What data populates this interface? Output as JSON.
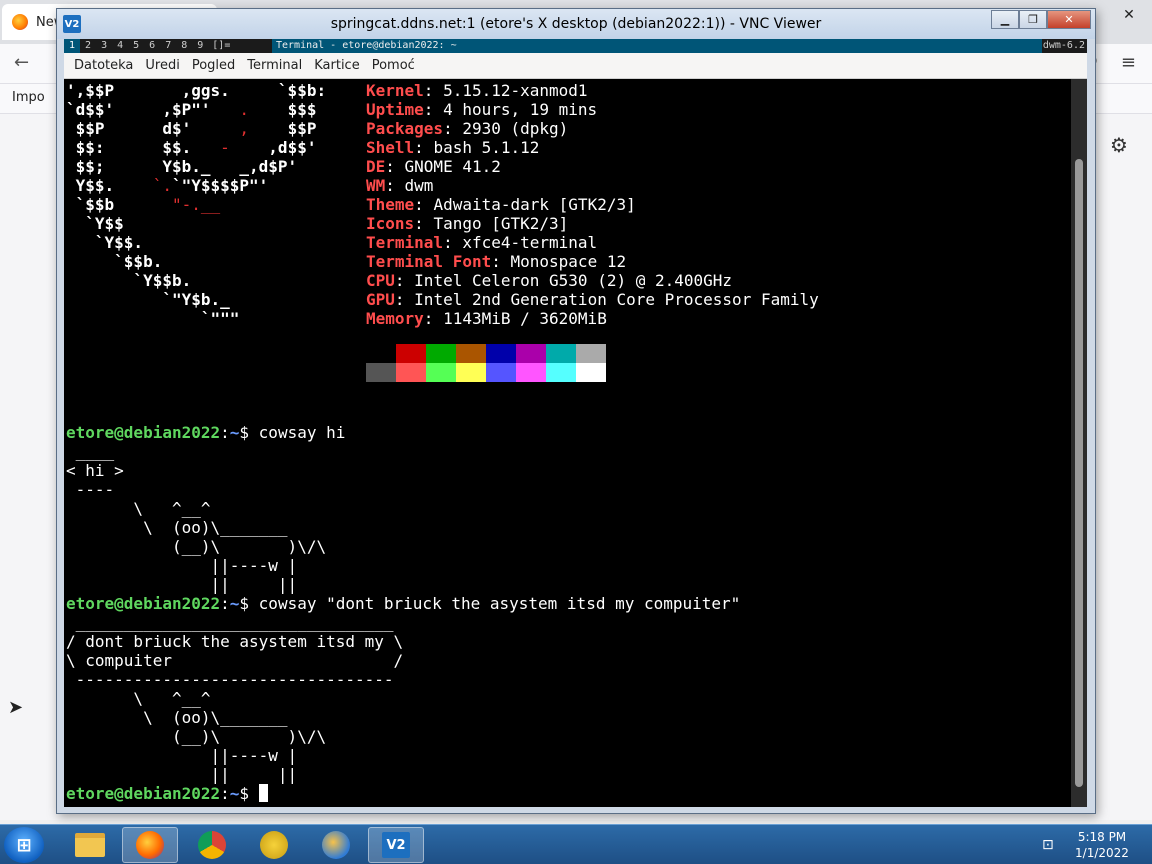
{
  "firefox": {
    "tab_label": "New",
    "bookmark_label": "Impo",
    "tab_close": "✕",
    "back_glyph": "←",
    "menu_glyph": "≡",
    "minimize_glyph": "—",
    "restore_glyph": "▢",
    "close_glyph": "✕",
    "gear_glyph": "⚙",
    "ext_glyph": "⊕"
  },
  "vnc": {
    "title": "springcat.ddns.net:1 (etore's X desktop (debian2022:1)) - VNC Viewer",
    "logo": "V2",
    "minimize": "▁",
    "restore": "❐",
    "close": "✕"
  },
  "dwm": {
    "tags": [
      "1",
      "2",
      "3",
      "4",
      "5",
      "6",
      "7",
      "8",
      "9"
    ],
    "active_tag": "1",
    "layout": "[]=",
    "window_title": "Terminal - etore@debian2022: ~",
    "status": "dwm-6.2"
  },
  "terminal_menu": [
    "Datoteka",
    "Uredi",
    "Pogled",
    "Terminal",
    "Kartice",
    "Pomoć"
  ],
  "neofetch": {
    "art": [
      {
        "white": "',$$P       ,ggs.     `$$b:",
        "red": ""
      },
      {
        "white": "`d$$'     ,$P\"'   ",
        "red": ".",
        "white2": "    $$$"
      },
      {
        "white": " $$P      d$'     ",
        "red": ",",
        "white2": "    $$P"
      },
      {
        "white": " $$:      $$.   ",
        "red": "-",
        "white2": "    ,d$$'"
      },
      {
        "white": " $$;      Y$b._   _,d$P'",
        "red": ""
      },
      {
        "white": " Y$$.    ",
        "red": "`.",
        "white2": "`\"Y$$$$P\"'"
      },
      {
        "white": " `$$b      ",
        "red": "\"-.__",
        "white2": ""
      },
      {
        "white": "  `Y$$",
        "red": "",
        "white2": ""
      },
      {
        "white": "   `Y$$.",
        "red": "",
        "white2": ""
      },
      {
        "white": "     `$$b.",
        "red": "",
        "white2": ""
      },
      {
        "white": "       `Y$$b.",
        "red": "",
        "white2": ""
      },
      {
        "white": "          `\"Y$b._",
        "red": "",
        "white2": ""
      },
      {
        "white": "              `\"\"\"",
        "red": "",
        "white2": ""
      }
    ],
    "info": [
      {
        "key": "Kernel",
        "value": "5.15.12-xanmod1"
      },
      {
        "key": "Uptime",
        "value": "4 hours, 19 mins"
      },
      {
        "key": "Packages",
        "value": "2930 (dpkg)"
      },
      {
        "key": "Shell",
        "value": "bash 5.1.12"
      },
      {
        "key": "DE",
        "value": "GNOME 41.2"
      },
      {
        "key": "WM",
        "value": "dwm"
      },
      {
        "key": "Theme",
        "value": "Adwaita-dark [GTK2/3]"
      },
      {
        "key": "Icons",
        "value": "Tango [GTK2/3]"
      },
      {
        "key": "Terminal",
        "value": "xfce4-terminal"
      },
      {
        "key": "Terminal Font",
        "value": "Monospace 12"
      },
      {
        "key": "CPU",
        "value": "Intel Celeron G530 (2) @ 2.400GHz"
      },
      {
        "key": "GPU",
        "value": "Intel 2nd Generation Core Processor Family"
      },
      {
        "key": "Memory",
        "value": "1143MiB / 3620MiB"
      }
    ],
    "palette_row1": [
      "#000000",
      "#cc0000",
      "#00aa00",
      "#aa5500",
      "#0000aa",
      "#aa00aa",
      "#00aaaa",
      "#aaaaaa"
    ],
    "palette_row2": [
      "#555555",
      "#ff5555",
      "#55ff55",
      "#ffff55",
      "#5555ff",
      "#ff55ff",
      "#55ffff",
      "#ffffff"
    ]
  },
  "session": {
    "prompt_user": "etore@debian2022",
    "prompt_sep": ":",
    "prompt_path": "~",
    "prompt_end": "$ ",
    "cmd1": "cowsay hi",
    "cow1": [
      " ____",
      "< hi >",
      " ----",
      "       \\   ^__^",
      "        \\  (oo)\\_______",
      "           (__)\\       )\\/\\",
      "               ||----w |",
      "               ||     ||"
    ],
    "cmd2": "cowsay \"dont briuck the asystem itsd my compuiter\"",
    "cow2": [
      " _________________________________",
      "/ dont briuck the asystem itsd my \\",
      "\\ compuiter                       /",
      " ---------------------------------",
      "       \\   ^__^",
      "        \\  (oo)\\_______",
      "           (__)\\       )\\/\\",
      "               ||----w |",
      "               ||     ||"
    ]
  },
  "taskbar": {
    "start_glyph": "⊞",
    "clock_time": "5:18 PM",
    "clock_date": "1/1/2022",
    "network_glyph": "⊡",
    "vnc_label": "V2"
  }
}
